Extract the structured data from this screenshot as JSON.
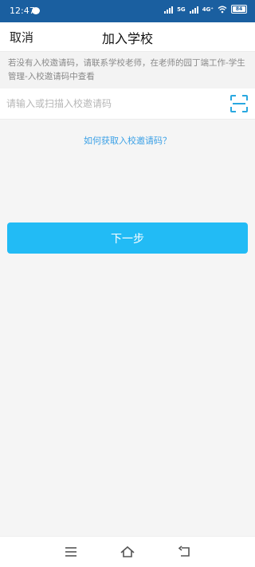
{
  "status_bar": {
    "time": "12:47",
    "signal_1_label": "5G",
    "signal_2_label": "4G⁺",
    "battery_level": "84"
  },
  "nav": {
    "cancel_label": "取消",
    "title": "加入学校"
  },
  "notice": {
    "text": "若没有入校邀请码，请联系学校老师，在老师的园丁端工作-学生管理-入校邀请码中查看"
  },
  "invite_input": {
    "placeholder": "请输入或扫描入校邀请码",
    "value": ""
  },
  "help_link": {
    "label": "如何获取入校邀请码？"
  },
  "next_button": {
    "label": "下一步"
  },
  "colors": {
    "status_bar": "#1a5fa0",
    "accent": "#22bbf5",
    "link": "#3aa0e6",
    "notice_text": "#8a8a8a"
  },
  "icons": {
    "scan": "scan-icon",
    "message": "message-icon",
    "menu": "menu-icon",
    "home": "home-icon",
    "back": "back-icon"
  }
}
